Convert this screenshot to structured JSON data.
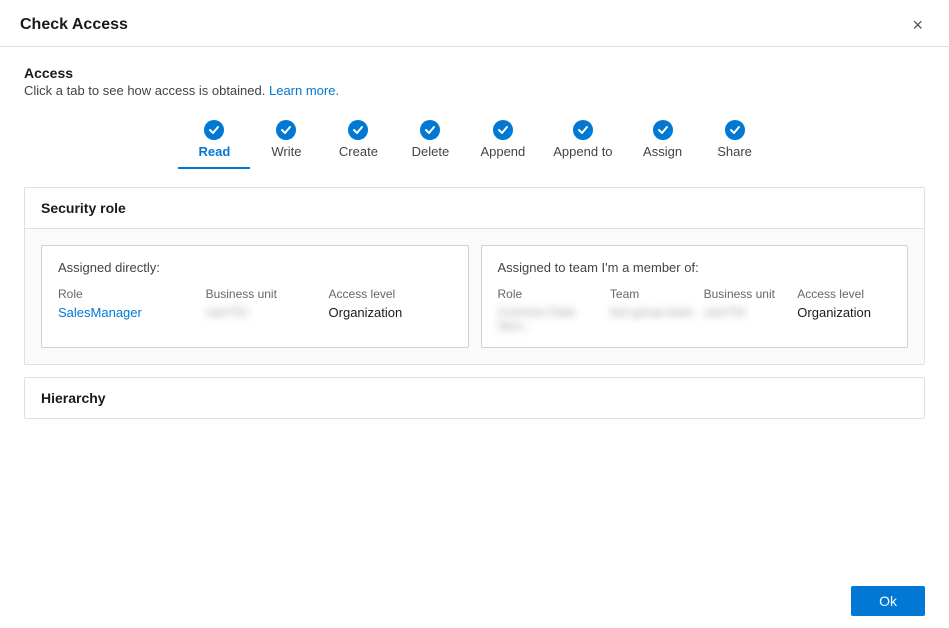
{
  "dialog": {
    "title": "Check Access",
    "close_label": "×"
  },
  "access_section": {
    "title": "Access",
    "subtitle": "Click a tab to see how access is obtained.",
    "learn_more_label": "Learn more.",
    "learn_more_href": "#"
  },
  "tabs": [
    {
      "id": "read",
      "label": "Read",
      "active": true
    },
    {
      "id": "write",
      "label": "Write",
      "active": false
    },
    {
      "id": "create",
      "label": "Create",
      "active": false
    },
    {
      "id": "delete",
      "label": "Delete",
      "active": false
    },
    {
      "id": "append",
      "label": "Append",
      "active": false
    },
    {
      "id": "append-to",
      "label": "Append to",
      "active": false
    },
    {
      "id": "assign",
      "label": "Assign",
      "active": false
    },
    {
      "id": "share",
      "label": "Share",
      "active": false
    }
  ],
  "security_role": {
    "section_title": "Security role",
    "assigned_directly": {
      "title": "Assigned directly:",
      "columns": [
        "Role",
        "Business unit",
        "Access level"
      ],
      "rows": [
        {
          "role_text1": "Sales",
          "role_text2": "Manager",
          "business_unit": "cam731",
          "access_level": "Organization"
        }
      ]
    },
    "assigned_team": {
      "title": "Assigned to team I'm a member of:",
      "columns": [
        "Role",
        "Team",
        "Business unit",
        "Access level"
      ],
      "rows": [
        {
          "role": "Common Data Serv...",
          "team": "test group team",
          "business_unit": "cam731",
          "access_level": "Organization"
        }
      ]
    }
  },
  "hierarchy": {
    "section_title": "Hierarchy"
  },
  "footer": {
    "ok_label": "Ok"
  }
}
